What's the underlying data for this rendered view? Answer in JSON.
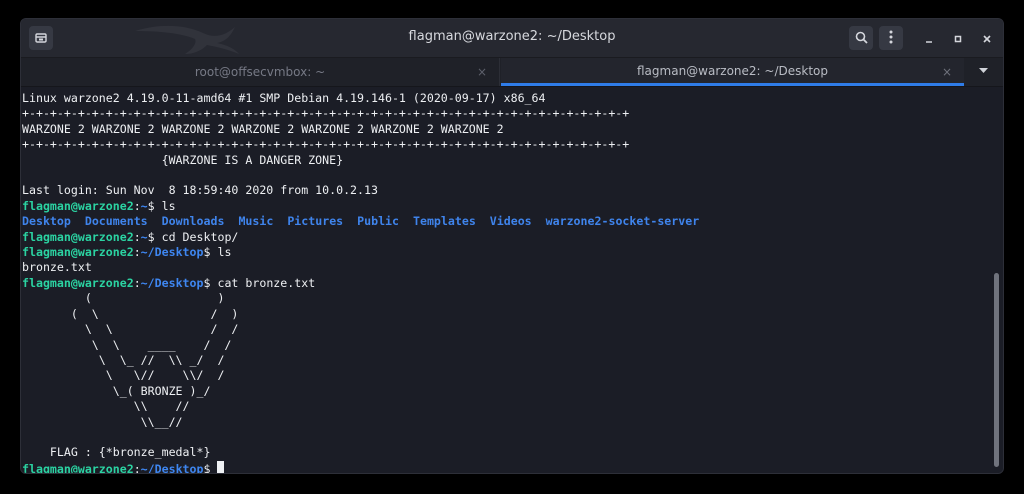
{
  "window": {
    "title": "flagman@warzone2: ~/Desktop"
  },
  "tabs": [
    {
      "label": "root@offsecvmbox: ~",
      "close": "×"
    },
    {
      "label": "flagman@warzone2: ~/Desktop",
      "close": "×"
    }
  ],
  "icons": {
    "new_tab": "new-tab-icon",
    "search": "search-icon",
    "menu": "kebab-menu-icon",
    "minimize": "minimize-icon",
    "maximize": "maximize-icon",
    "close": "close-icon",
    "tab_dropdown": "chevron-down-icon",
    "dragon": "kali-dragon-logo"
  },
  "colors": {
    "prompt_user": "#2bd3a2",
    "prompt_path": "#3e86f0",
    "directory": "#3f84ec",
    "active_tab_underline": "#2f7ce8",
    "background": "#1b1d26"
  },
  "terminal": {
    "motd": [
      "Linux warzone2 4.19.0-11-amd64 #1 SMP Debian 4.19.146-1 (2020-09-17) x86_64",
      "+-+-+-+-+-+-+-+-+-+-+-+-+-+-+-+-+-+-+-+-+-+-+-+-+-+-+-+-+-+-+-+-+-+-+-+-+-+-+-+-+-+-+-+",
      "WARZONE 2 WARZONE 2 WARZONE 2 WARZONE 2 WARZONE 2 WARZONE 2 WARZONE 2",
      "+-+-+-+-+-+-+-+-+-+-+-+-+-+-+-+-+-+-+-+-+-+-+-+-+-+-+-+-+-+-+-+-+-+-+-+-+-+-+-+-+-+-+-+",
      "                    {WARZONE IS A DANGER ZONE}",
      "",
      "Last login: Sun Nov  8 18:59:40 2020 from 10.0.2.13"
    ],
    "prompt_user": "flagman@warzone2",
    "prompt_sep": ":",
    "home_path": "~",
    "desktop_path": "~/Desktop",
    "prompt_end": "$",
    "cmd1": " ls",
    "ls_home": [
      "Desktop",
      "Documents",
      "Downloads",
      "Music",
      "Pictures",
      "Public",
      "Templates",
      "Videos",
      "warzone2-socket-server"
    ],
    "cmd2": " cd Desktop/",
    "cmd3": " ls",
    "ls_desktop": "bronze.txt",
    "cmd4": " cat bronze.txt",
    "art": [
      "         (                  )",
      "       (  \\                /  )",
      "         \\  \\              /  /",
      "          \\  \\    ____    /  /",
      "           \\  \\_ //  \\\\ _/  /",
      "            \\   \\//    \\\\/  /",
      "             \\_( BRONZE )_/",
      "                \\\\    //",
      "                 \\\\__//",
      "",
      "    FLAG : {*bronze_medal*}"
    ]
  }
}
